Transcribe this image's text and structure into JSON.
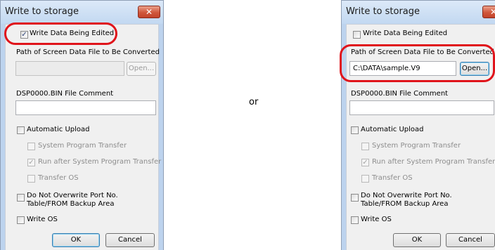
{
  "left_dialog": {
    "title": "Write to storage",
    "close_glyph": "✕",
    "write_data_edited": {
      "label": "Write Data Being Edited",
      "checked": true
    },
    "path_label": "Path of Screen Data File to Be Converted",
    "path_value": "",
    "open_button": "Open...",
    "comment_label": "DSP0000.BIN File Comment",
    "comment_value": "",
    "auto_upload": {
      "label": "Automatic Upload",
      "checked": false
    },
    "system_program_transfer": {
      "label": "System Program Transfer",
      "checked": false
    },
    "run_after": {
      "label": "Run after System Program Transfer",
      "checked": true
    },
    "transfer_os": {
      "label": "Transfer OS",
      "checked": false
    },
    "no_overwrite": {
      "label_line1": "Do Not Overwrite Port No.",
      "label_line2": "Table/FROM Backup Area",
      "checked": false
    },
    "write_os": {
      "label": "Write OS",
      "checked": false
    },
    "ok_button": "OK",
    "cancel_button": "Cancel"
  },
  "separator_text": "or",
  "right_dialog": {
    "title": "Write to storage",
    "close_glyph": "✕",
    "write_data_edited": {
      "label": "Write Data Being Edited",
      "checked": false
    },
    "path_label": "Path of Screen Data File to Be Converted",
    "path_value": "C:\\DATA\\sample.V9",
    "open_button": "Open...",
    "comment_label": "DSP0000.BIN File Comment",
    "comment_value": "",
    "auto_upload": {
      "label": "Automatic Upload",
      "checked": false
    },
    "system_program_transfer": {
      "label": "System Program Transfer",
      "checked": false
    },
    "run_after": {
      "label": "Run after System Program Transfer",
      "checked": true
    },
    "transfer_os": {
      "label": "Transfer OS",
      "checked": false
    },
    "no_overwrite": {
      "label_line1": "Do Not Overwrite Port No.",
      "label_line2": "Table/FROM Backup Area",
      "checked": false
    },
    "write_os": {
      "label": "Write OS",
      "checked": false
    },
    "ok_button": "OK",
    "cancel_button": "Cancel"
  },
  "colors": {
    "highlight": "#e0141b",
    "title_bar": "#c2d8f1",
    "close_button": "#d0573c"
  },
  "icons": {
    "close": "close-icon",
    "check": "check-icon"
  }
}
